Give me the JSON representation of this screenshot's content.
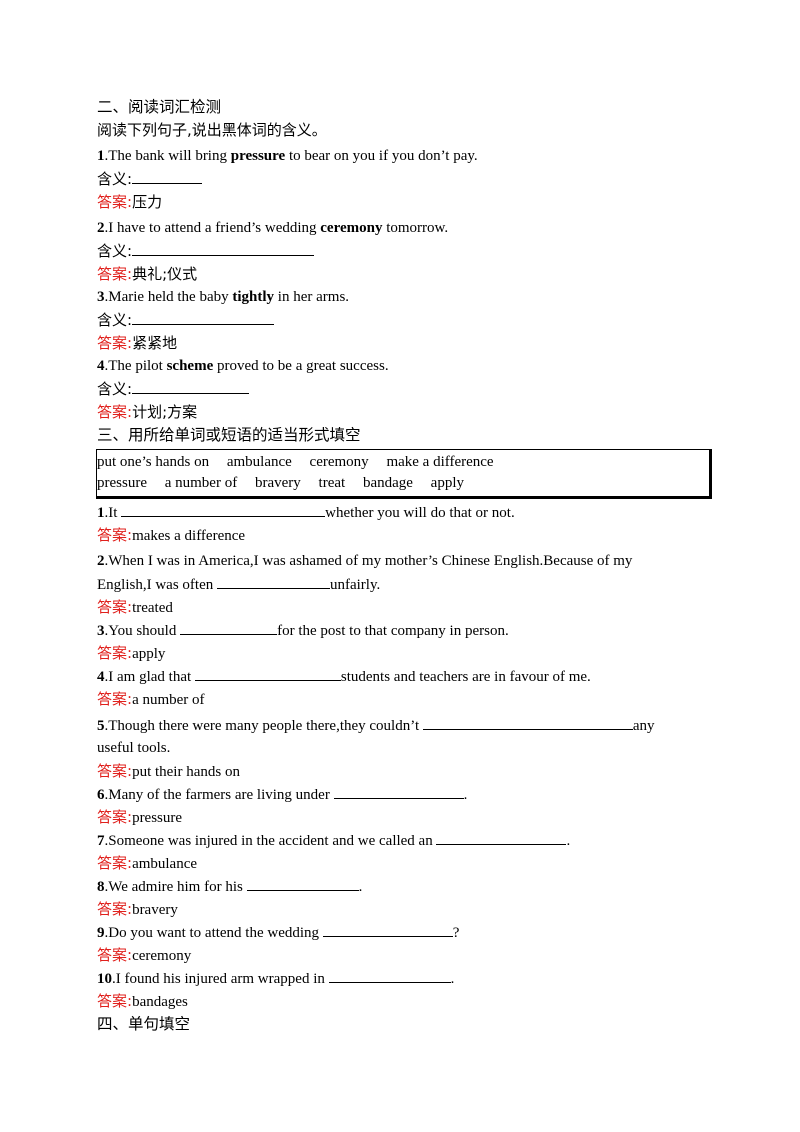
{
  "section2": {
    "heading": "二、阅读词汇检测",
    "instruction": "阅读下列句子,说出黑体词的含义。",
    "meaning_label": "含义:",
    "answer_label": "答案:",
    "items": [
      {
        "num": "1",
        "before": ".The bank will bring ",
        "bold": "pressure",
        "after": " to bear on you if you don’t pay.",
        "answer": "压力"
      },
      {
        "num": "2",
        "before": ".I have to attend a friend’s wedding ",
        "bold": "ceremony",
        "after": " tomorrow.",
        "answer": "典礼;仪式"
      },
      {
        "num": "3",
        "before": ".Marie held the baby ",
        "bold": "tightly",
        "after": " in her arms.",
        "answer": "紧紧地"
      },
      {
        "num": "4",
        "before": ".The pilot ",
        "bold": "scheme",
        "after": " proved to be a great success.",
        "answer": "计划;方案"
      }
    ]
  },
  "section3": {
    "heading": "三、用所给单词或短语的适当形式填空",
    "word_box": {
      "row1": [
        "put one’s hands on",
        "ambulance",
        "ceremony",
        "make a difference"
      ],
      "row2": [
        "pressure",
        "a number of",
        "bravery",
        "treat",
        "bandage",
        "apply"
      ]
    },
    "answer_label": "答案:",
    "items": [
      {
        "num": "1",
        "before": ".It ",
        "after": "whether you will do that or not.",
        "answer": "makes a difference"
      },
      {
        "num": "2",
        "before": ".When I was in America,I was ashamed of my mother’s Chinese English.Because of my",
        "line2_before": "English,I was often ",
        "after": "unfairly.",
        "answer": "treated"
      },
      {
        "num": "3",
        "before": ".You should ",
        "after": "for the post to that company in person.",
        "answer": "apply"
      },
      {
        "num": "4",
        "before": ".I am glad that ",
        "after": "students and teachers are in favour of me.",
        "answer": "a number of"
      },
      {
        "num": "5",
        "before": ".Though there were many people there,they couldn’t ",
        "after": "any",
        "line2": "useful tools.",
        "answer": "put their hands on"
      },
      {
        "num": "6",
        "before": ".Many of the farmers are living under ",
        "after": ".",
        "answer": "pressure"
      },
      {
        "num": "7",
        "before": ".Someone was injured in the accident and we called an ",
        "after": ".",
        "answer": "ambulance"
      },
      {
        "num": "8",
        "before": ".We admire him for his ",
        "after": ".",
        "answer": "bravery"
      },
      {
        "num": "9",
        "before": ".Do you want to attend the wedding ",
        "after": "?",
        "answer": "ceremony"
      },
      {
        "num": "10",
        "before": ".I found his injured arm wrapped in ",
        "after": ".",
        "answer": "bandages"
      }
    ]
  },
  "section4": {
    "heading": "四、单句填空"
  }
}
